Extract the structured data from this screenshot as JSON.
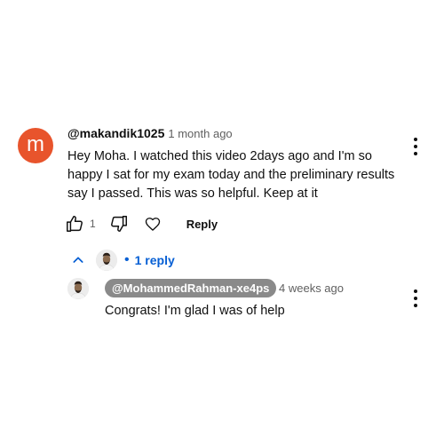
{
  "comment": {
    "avatar_letter": "m",
    "avatar_color": "#e8542c",
    "author": "@makandik1025",
    "time": "1 month ago",
    "text": "Hey Moha. I watched this video 2days ago and I'm so happy I sat for my exam today and the preliminary results say I passed. This was so helpful. Keep at it",
    "like_count": "1",
    "reply_label": "Reply",
    "icons": [
      "thumbs-up-icon",
      "thumbs-down-icon",
      "heart-icon",
      "more-vert-icon"
    ]
  },
  "replies_toggle": {
    "label": "1 reply",
    "separator": "•",
    "icon": "chevron-up-icon",
    "accent": "#065fd4"
  },
  "reply": {
    "author": "@MohammedRahman-xe4ps",
    "time": "4 weeks ago",
    "text": "Congrats! I'm glad I was of help",
    "chip_color": "#8a8a8a"
  }
}
